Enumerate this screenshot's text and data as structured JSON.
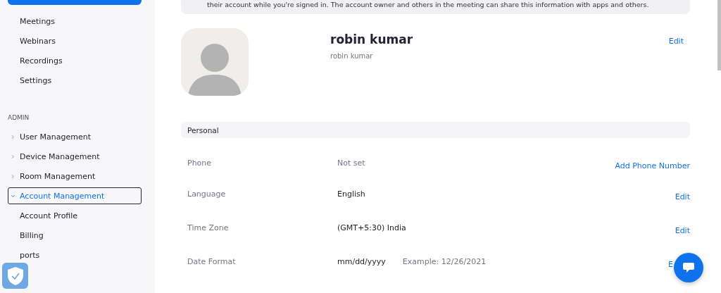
{
  "sidebar": {
    "top_items": [
      {
        "label": "Meetings",
        "selected": false
      },
      {
        "label": "Webinars",
        "selected": false
      },
      {
        "label": "Recordings",
        "selected": false
      },
      {
        "label": "Settings",
        "selected": false
      }
    ],
    "section_title": "ADMIN",
    "admin_items": [
      {
        "label": "User Management",
        "kind": "group",
        "expanded": false,
        "selected": false
      },
      {
        "label": "Device Management",
        "kind": "group",
        "expanded": false,
        "selected": false
      },
      {
        "label": "Room Management",
        "kind": "group",
        "expanded": false,
        "selected": false
      },
      {
        "label": "Account Management",
        "kind": "group",
        "expanded": true,
        "selected": true
      },
      {
        "label": "Account Profile",
        "kind": "link",
        "selected": false
      },
      {
        "label": "Billing",
        "kind": "link",
        "selected": false
      },
      {
        "label": "ports",
        "kind": "link",
        "selected": false
      }
    ]
  },
  "notice": {
    "text": "their account while you're signed in. The account owner and others in the meeting can share this information with apps and others."
  },
  "profile": {
    "name": "robin kumar",
    "display_name": "robin kumar",
    "action": "Edit"
  },
  "personal": {
    "title": "Personal",
    "rows": [
      {
        "label": "Phone",
        "value": "Not set",
        "value_muted": true,
        "action": "Add Phone Number"
      },
      {
        "label": "Language",
        "value": "English",
        "value_muted": false,
        "action": "Edit"
      },
      {
        "label": "Time Zone",
        "value": "(GMT+5:30) India",
        "value_muted": false,
        "action": "Edit"
      },
      {
        "label": "Date Format",
        "value": "mm/dd/yyyy",
        "value_muted": false,
        "example": "Example: 12/26/2021",
        "action": "E"
      }
    ]
  }
}
